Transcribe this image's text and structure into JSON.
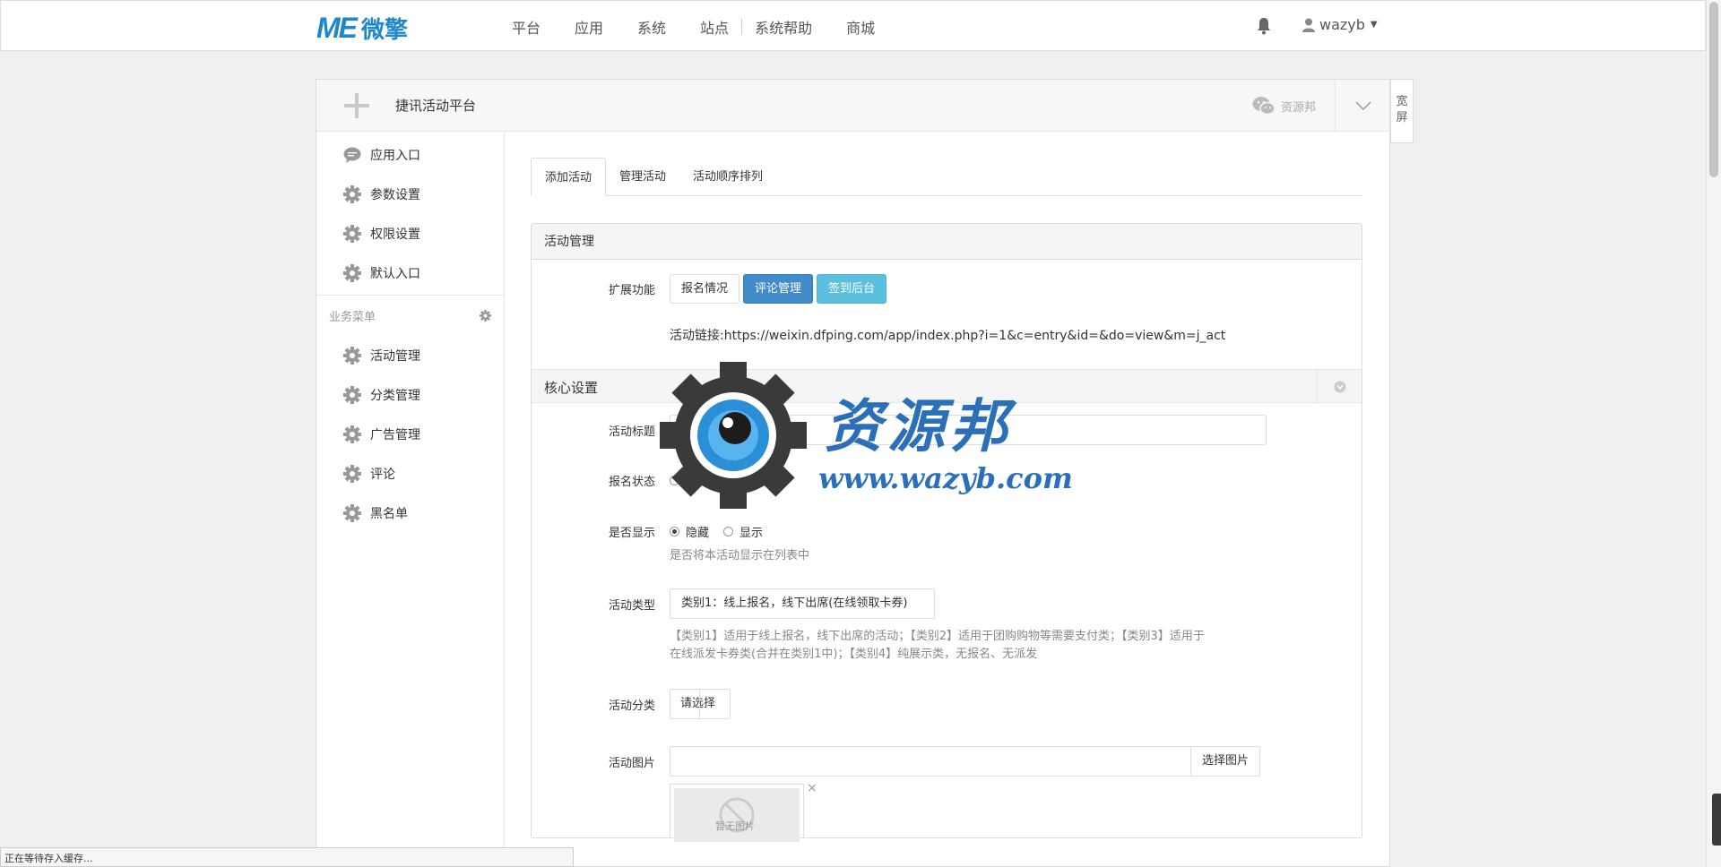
{
  "topbar": {
    "logo_mark": "ME",
    "logo_text": "微擎",
    "nav": [
      "平台",
      "应用",
      "系统",
      "站点",
      "系统帮助",
      "商城"
    ],
    "username": "wazyb"
  },
  "panel": {
    "app_title": "捷讯活动平台",
    "wechat_account": "资源邦",
    "wide_label": "宽屏"
  },
  "sidebar": {
    "top_items": [
      {
        "label": "应用入口",
        "icon": "chat-bubble-icon"
      },
      {
        "label": "参数设置",
        "icon": "gear-icon"
      },
      {
        "label": "权限设置",
        "icon": "gear-icon"
      },
      {
        "label": "默认入口",
        "icon": "gear-icon"
      }
    ],
    "section_label": "业务菜单",
    "business_items": [
      {
        "label": "活动管理",
        "icon": "gear-icon"
      },
      {
        "label": "分类管理",
        "icon": "gear-icon"
      },
      {
        "label": "广告管理",
        "icon": "gear-icon"
      },
      {
        "label": "评论",
        "icon": "gear-icon"
      },
      {
        "label": "黑名单",
        "icon": "gear-icon"
      }
    ]
  },
  "tabs": [
    "添加活动",
    "管理活动",
    "活动顺序排列"
  ],
  "form": {
    "card_title": "活动管理",
    "ext_label": "扩展功能",
    "ext_buttons": [
      "报名情况",
      "评论管理",
      "签到后台"
    ],
    "activity_link": "活动链接:https://weixin.dfping.com/app/index.php?i=1&c=entry&id=&do=view&m=j_act",
    "core_section": "核心设置",
    "title_label": "活动标题",
    "title_value": "",
    "signup_label": "报名状态",
    "signup_options": [
      "进行中",
      "暂停"
    ],
    "show_label": "是否显示",
    "show_options": [
      "隐藏",
      "显示"
    ],
    "show_selected": "隐藏",
    "show_help": "是否将本活动显示在列表中",
    "type_label": "活动类型",
    "type_value": "类别1：线上报名，线下出席(在线领取卡券)",
    "type_help_1": "【类别1】适用于线上报名，线下出席的活动；【类别2】适用于团购购物等需要支付类；【类别3】适用于",
    "type_help_2": "在线派发卡券类(合并在类别1中)；【类别4】纯展示类，无报名、无派发",
    "category_label": "活动分类",
    "category_value": "请选择",
    "image_label": "活动图片",
    "image_button": "选择图片",
    "image_placeholder": "暂无图片",
    "image_remove": "×"
  },
  "watermark": {
    "text": "资源邦",
    "url": "www.wazyb.com"
  },
  "status_bar": "正在等待存入缓存..."
}
